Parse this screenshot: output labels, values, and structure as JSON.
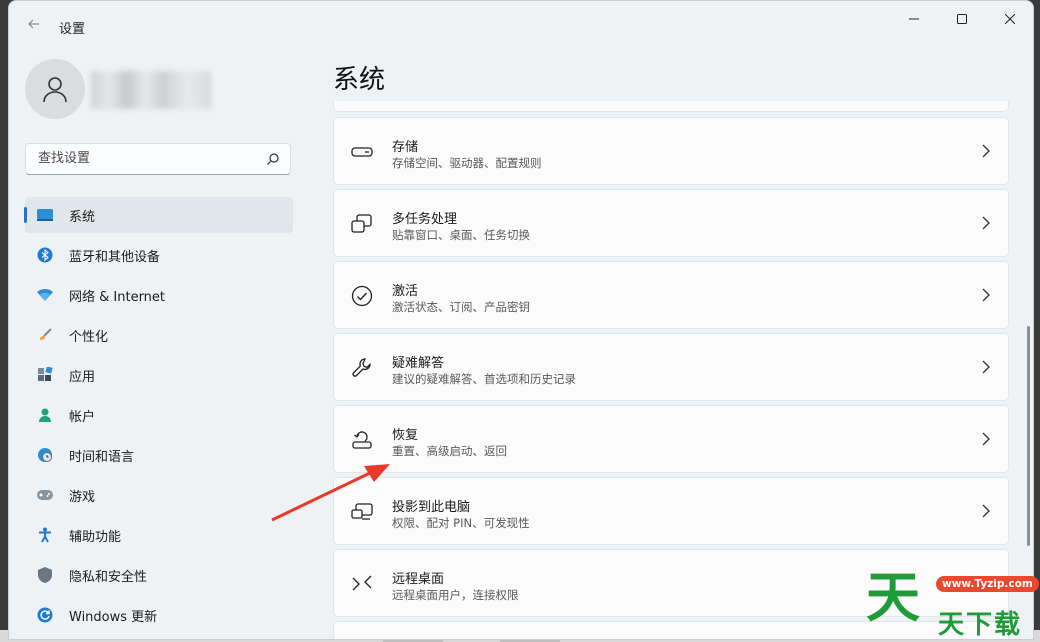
{
  "window": {
    "title": "设置",
    "controls": [
      "minimize",
      "maximize",
      "close"
    ]
  },
  "search": {
    "placeholder": "查找设置"
  },
  "nav": [
    {
      "label": "系统",
      "icon": "monitor-icon",
      "active": true
    },
    {
      "label": "蓝牙和其他设备",
      "icon": "bluetooth-icon"
    },
    {
      "label": "网络 & Internet",
      "icon": "wifi-icon"
    },
    {
      "label": "个性化",
      "icon": "brush-icon"
    },
    {
      "label": "应用",
      "icon": "apps-icon"
    },
    {
      "label": "帐户",
      "icon": "person-icon"
    },
    {
      "label": "时间和语言",
      "icon": "globe-clock-icon"
    },
    {
      "label": "游戏",
      "icon": "gamepad-icon"
    },
    {
      "label": "辅助功能",
      "icon": "accessibility-icon"
    },
    {
      "label": "隐私和安全性",
      "icon": "shield-icon"
    },
    {
      "label": "Windows 更新",
      "icon": "update-icon"
    }
  ],
  "main": {
    "title": "系统",
    "cards": [
      {
        "title": "存储",
        "subtitle": "存储空间、驱动器、配置规则",
        "icon": "storage-icon"
      },
      {
        "title": "多任务处理",
        "subtitle": "贴靠窗口、桌面、任务切换",
        "icon": "multitask-icon"
      },
      {
        "title": "激活",
        "subtitle": "激活状态、订阅、产品密钥",
        "icon": "check-circle-icon"
      },
      {
        "title": "疑难解答",
        "subtitle": "建议的疑难解答、首选项和历史记录",
        "icon": "wrench-icon"
      },
      {
        "title": "恢复",
        "subtitle": "重置、高级启动、返回",
        "icon": "recovery-icon"
      },
      {
        "title": "投影到此电脑",
        "subtitle": "权限、配对 PIN、可发现性",
        "icon": "project-icon"
      },
      {
        "title": "远程桌面",
        "subtitle": "远程桌面用户，连接权限",
        "icon": "remote-desktop-icon"
      }
    ]
  },
  "watermark": {
    "glyph": "天",
    "site": "www.Tyzip.com",
    "brand": "天下载"
  },
  "colors": {
    "accent": "#2d6fc5",
    "arrow": "#e8392a",
    "watermark_green": "#1f9b3a"
  }
}
